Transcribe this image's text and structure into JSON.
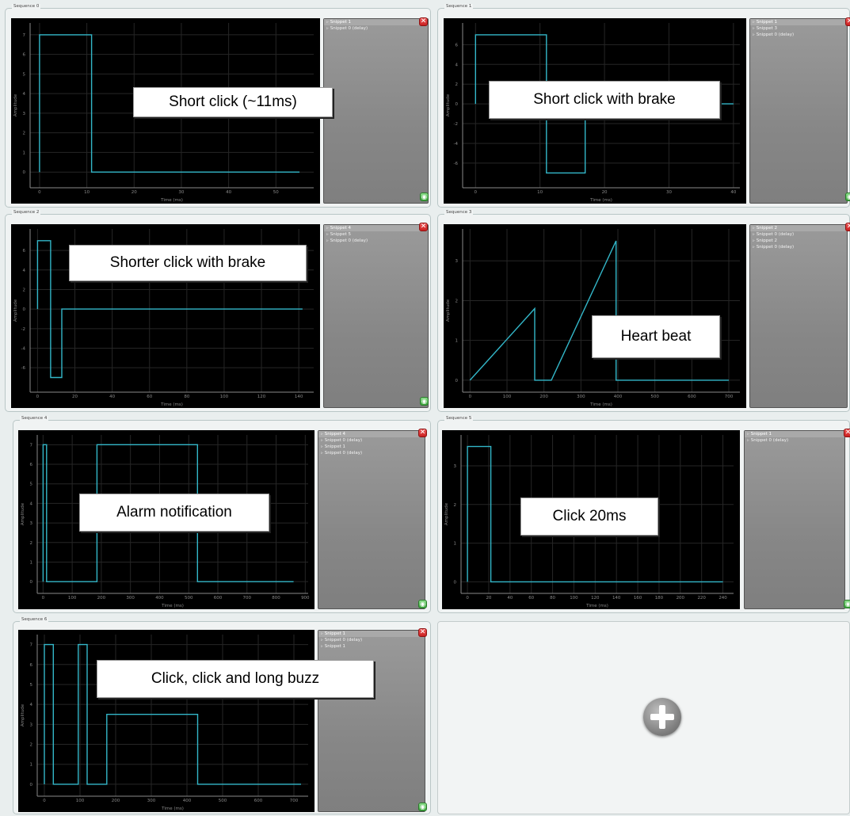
{
  "sequences": [
    {
      "title": "Sequence 0",
      "caption": "Short click (~11ms)",
      "snippets": [
        "Snippet 1",
        "Snippet 0 (delay)"
      ],
      "plot": {
        "xlabel": "Time (ms)",
        "ylabel": "Amplitude",
        "xlim": [
          -2,
          58
        ],
        "ylim": [
          -0.8,
          7.6
        ],
        "xticks": [
          0,
          10,
          20,
          30,
          40,
          50
        ],
        "yticks": [
          0,
          1,
          2,
          3,
          4,
          5,
          6,
          7
        ],
        "points": [
          [
            0,
            0
          ],
          [
            0,
            7
          ],
          [
            11,
            7
          ],
          [
            11,
            0
          ],
          [
            55,
            0
          ]
        ]
      }
    },
    {
      "title": "Sequence 1",
      "caption": "Short click with brake",
      "snippets": [
        "Snippet 1",
        "Snippet 3",
        "Snippet 0 (delay)"
      ],
      "plot": {
        "xlabel": "Time (ms)",
        "ylabel": "Amplitude",
        "xlim": [
          -2,
          41
        ],
        "ylim": [
          -8.5,
          8.2
        ],
        "xticks": [
          0,
          10,
          20,
          30,
          40
        ],
        "yticks": [
          -6,
          -4,
          -2,
          0,
          2,
          4,
          6
        ],
        "points": [
          [
            0,
            0
          ],
          [
            0,
            7
          ],
          [
            11,
            7
          ],
          [
            11,
            -7
          ],
          [
            17,
            -7
          ],
          [
            17,
            0
          ],
          [
            40,
            0
          ]
        ]
      }
    },
    {
      "title": "Sequence 2",
      "caption": "Shorter click with brake",
      "snippets": [
        "Snippet 4",
        "Snippet 5",
        "Snippet 0 (delay)"
      ],
      "plot": {
        "xlabel": "Time (ms)",
        "ylabel": "Amplitude",
        "xlim": [
          -4,
          148
        ],
        "ylim": [
          -8.5,
          8.2
        ],
        "xticks": [
          0,
          20,
          40,
          60,
          80,
          100,
          120,
          140
        ],
        "yticks": [
          -6,
          -4,
          -2,
          0,
          2,
          4,
          6
        ],
        "points": [
          [
            0,
            0
          ],
          [
            0,
            7
          ],
          [
            7,
            7
          ],
          [
            7,
            -7
          ],
          [
            13,
            -7
          ],
          [
            13,
            0
          ],
          [
            142,
            0
          ]
        ]
      }
    },
    {
      "title": "Sequence 3",
      "caption": "Heart beat",
      "snippets": [
        "Snippet 2",
        "Snippet 0 (delay)",
        "Snippet 2",
        "Snippet 0 (delay)"
      ],
      "plot": {
        "xlabel": "Time (ms)",
        "ylabel": "Amplitude",
        "xlim": [
          -20,
          730
        ],
        "ylim": [
          -0.3,
          3.8
        ],
        "xticks": [
          0,
          100,
          200,
          300,
          400,
          500,
          600,
          700
        ],
        "yticks": [
          0,
          1,
          2,
          3
        ],
        "points": [
          [
            0,
            0
          ],
          [
            175,
            1.8
          ],
          [
            175,
            0
          ],
          [
            220,
            0
          ],
          [
            395,
            3.5
          ],
          [
            395,
            0
          ],
          [
            700,
            0
          ]
        ]
      }
    },
    {
      "title": "Sequence 4",
      "caption": "Alarm notification",
      "snippets": [
        "Snippet 4",
        "Snippet 0 (delay)",
        "Snippet 1",
        "Snippet 0 (delay)"
      ],
      "plot": {
        "xlabel": "Time (ms)",
        "ylabel": "Amplitude",
        "xlim": [
          -20,
          910
        ],
        "ylim": [
          -0.6,
          7.5
        ],
        "xticks": [
          0,
          100,
          200,
          300,
          400,
          500,
          600,
          700,
          800,
          900
        ],
        "yticks": [
          0,
          1,
          2,
          3,
          4,
          5,
          6,
          7
        ],
        "points": [
          [
            0,
            0
          ],
          [
            0,
            7
          ],
          [
            12,
            7
          ],
          [
            12,
            0
          ],
          [
            185,
            0
          ],
          [
            185,
            7
          ],
          [
            530,
            7
          ],
          [
            530,
            0
          ],
          [
            860,
            0
          ]
        ]
      }
    },
    {
      "title": "Sequence 5",
      "caption": "Click 20ms",
      "snippets": [
        "Snippet 1",
        "Snippet 0 (delay)"
      ],
      "plot": {
        "xlabel": "Time (ms)",
        "ylabel": "Amplitude",
        "xlim": [
          -6,
          250
        ],
        "ylim": [
          -0.3,
          3.8
        ],
        "xticks": [
          0,
          20,
          40,
          60,
          80,
          100,
          120,
          140,
          160,
          180,
          200,
          220,
          240
        ],
        "yticks": [
          0,
          1,
          2,
          3
        ],
        "points": [
          [
            0,
            0
          ],
          [
            0,
            3.5
          ],
          [
            22,
            3.5
          ],
          [
            22,
            0
          ],
          [
            240,
            0
          ]
        ]
      }
    },
    {
      "title": "Sequence 6",
      "caption": "Click, click and long buzz",
      "snippets": [
        "Snippet 1",
        "Snippet 0 (delay)",
        "Snippet 1"
      ],
      "plot": {
        "xlabel": "Time (ms)",
        "ylabel": "Amplitude",
        "xlim": [
          -20,
          740
        ],
        "ylim": [
          -0.6,
          7.5
        ],
        "xticks": [
          0,
          100,
          200,
          300,
          400,
          500,
          600,
          700
        ],
        "yticks": [
          0,
          1,
          2,
          3,
          4,
          5,
          6,
          7
        ],
        "points": [
          [
            0,
            0
          ],
          [
            0,
            7
          ],
          [
            25,
            7
          ],
          [
            25,
            0
          ],
          [
            95,
            0
          ],
          [
            95,
            7
          ],
          [
            120,
            7
          ],
          [
            120,
            0
          ],
          [
            175,
            0
          ],
          [
            175,
            3.5
          ],
          [
            430,
            3.5
          ],
          [
            430,
            0
          ],
          [
            720,
            0
          ]
        ]
      }
    }
  ],
  "icons": {
    "delete": "close-icon",
    "apply": "apply-icon",
    "add": "plus-icon"
  },
  "colors": {
    "trace": "#33b7c9",
    "grid": "#262626",
    "axis": "#8a8a8a"
  },
  "glyphs": {
    "delete": "✕",
    "apply": "◉"
  }
}
